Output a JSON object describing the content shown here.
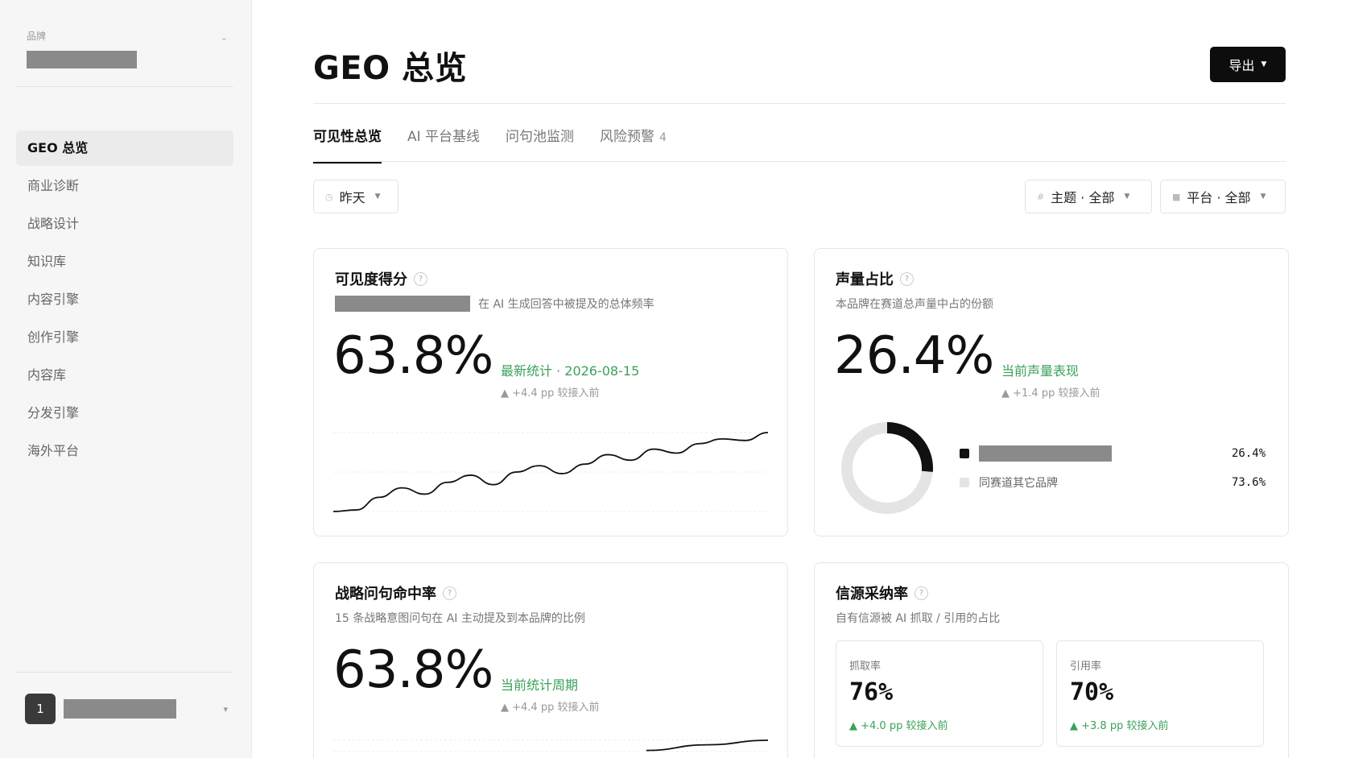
{
  "sidebar": {
    "brand_label": "品牌",
    "items": [
      {
        "label": "GEO 总览",
        "active": true
      },
      {
        "label": "商业诊断"
      },
      {
        "label": "战略设计"
      },
      {
        "label": "知识库"
      },
      {
        "label": "内容引擎"
      },
      {
        "label": "创作引擎"
      },
      {
        "label": "内容库"
      },
      {
        "label": "分发引擎"
      },
      {
        "label": "海外平台"
      }
    ],
    "user_avatar": "1"
  },
  "header": {
    "title": "GEO 总览",
    "export_label": "导出"
  },
  "tabs": [
    {
      "label": "可见性总览",
      "active": true
    },
    {
      "label": "AI 平台基线"
    },
    {
      "label": "问句池监测"
    },
    {
      "label": "风险预警",
      "badge": "4"
    }
  ],
  "filters": {
    "date": "昨天",
    "topic": "主题 · 全部",
    "platform": "平台 · 全部"
  },
  "cards": {
    "visibility": {
      "title": "可见度得分",
      "subtitle": "在 AI 生成回答中被提及的总体频率",
      "value": "63.8%",
      "meta": "最新统计 · 2026-08-15",
      "delta": "▲ +4.4 pp 较接入前"
    },
    "sov": {
      "title": "声量占比",
      "subtitle": "本品牌在赛道总声量中占的份额",
      "value": "26.4%",
      "meta": "当前声量表现",
      "delta": "▲ +1.4 pp 较接入前",
      "legend_other": "同赛道其它品牌",
      "value_brand": "26.4%",
      "value_other": "73.6%"
    },
    "hit_rate": {
      "title": "战略问句命中率",
      "subtitle": "15 条战略意图问句在 AI 主动提及到本品牌的比例",
      "value": "63.8%",
      "meta": "当前统计周期",
      "delta": "▲ +4.4 pp 较接入前"
    },
    "source": {
      "title": "信源采纳率",
      "subtitle": "自有信源被 AI 抓取 / 引用的占比",
      "crawl_label": "抓取率",
      "crawl_value": "76%",
      "crawl_delta": "▲ +4.0 pp 较接入前",
      "cite_label": "引用率",
      "cite_value": "70%",
      "cite_delta": "▲ +3.8 pp 较接入前"
    }
  },
  "chart_data": [
    {
      "type": "line",
      "values": [
        0.0,
        0.02,
        0.18,
        0.3,
        0.22,
        0.37,
        0.46,
        0.34,
        0.5,
        0.58,
        0.48,
        0.6,
        0.72,
        0.65,
        0.79,
        0.74,
        0.86,
        0.92,
        0.9,
        1.0
      ],
      "grid": true
    },
    {
      "type": "pie",
      "categories": [
        "",
        "同赛道其它品牌"
      ],
      "values": [
        26.4,
        73.6
      ],
      "colors": [
        "#111111",
        "#e4e4e4"
      ]
    },
    {
      "type": "line",
      "values": [
        0.55,
        0.8,
        1.0
      ],
      "grid": true
    }
  ],
  "colors": {
    "accent_green": "#3aa15a",
    "primary": "#0d0d0d"
  }
}
